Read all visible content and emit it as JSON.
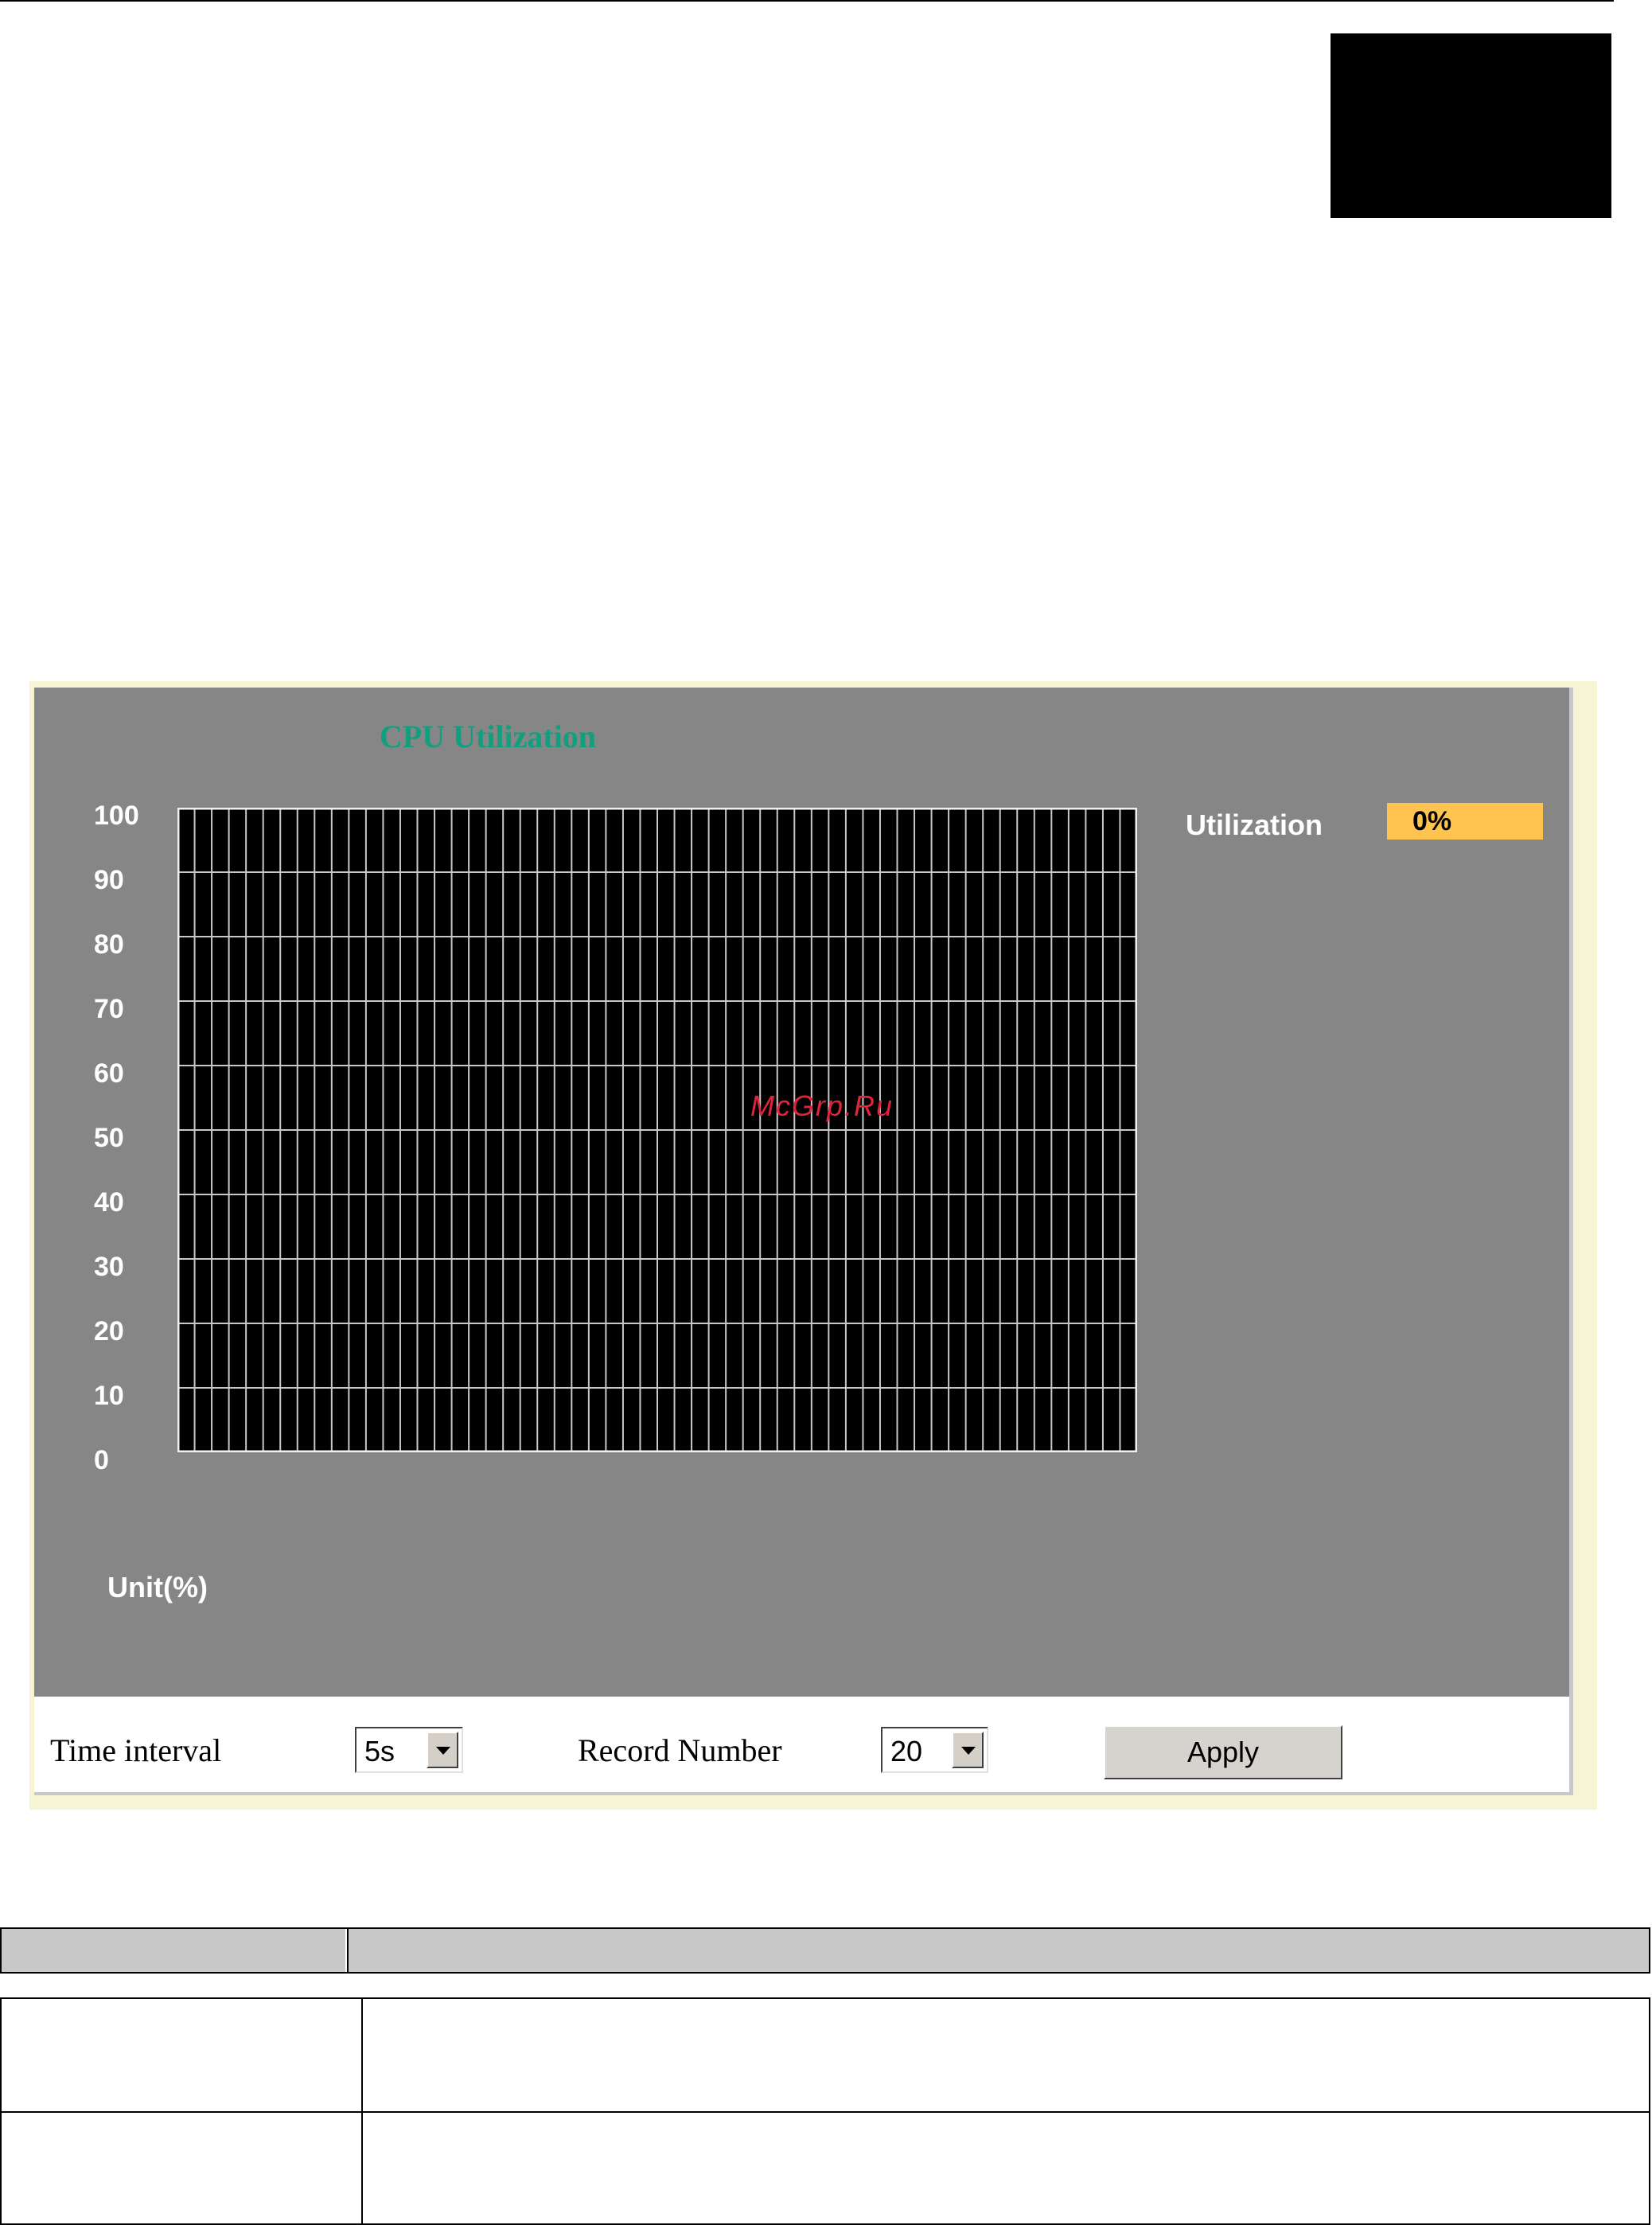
{
  "chart": {
    "title": "CPU Utilization",
    "y_ticks": [
      "100",
      "90",
      "80",
      "70",
      "60",
      "50",
      "40",
      "30",
      "20",
      "10",
      "0"
    ],
    "unit_label": "Unit(%)",
    "watermark": "McGrp.Ru"
  },
  "utilization": {
    "label": "Utilization",
    "value": "0%"
  },
  "controls": {
    "time_interval_label": "Time interval",
    "time_interval_value": "5s",
    "record_number_label": "Record Number",
    "record_number_value": "20",
    "apply_label": "Apply"
  },
  "chart_data": {
    "type": "line",
    "title": "CPU Utilization",
    "xlabel": "",
    "ylabel": "Unit(%)",
    "ylim": [
      0,
      100
    ],
    "y_ticks": [
      0,
      10,
      20,
      30,
      40,
      50,
      60,
      70,
      80,
      90,
      100
    ],
    "grid": true,
    "series": []
  },
  "colors": {
    "panel_bg": "#868686",
    "plot_bg": "#000000",
    "grid_line": "#c8c8c8",
    "title": "#10a080",
    "utilization_bg": "#ffc34f",
    "frame_bg": "#f7f4d6"
  }
}
